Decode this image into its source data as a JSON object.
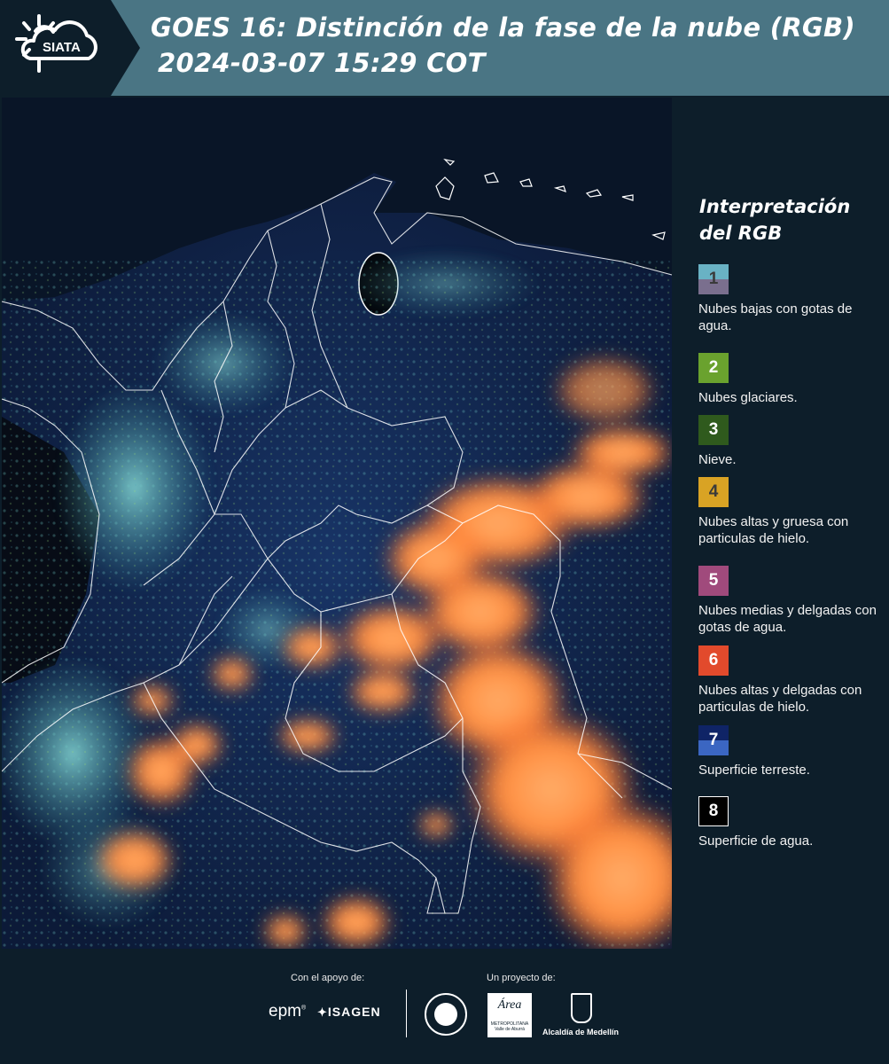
{
  "header": {
    "logo_text": "SIATA",
    "title_line1": "GOES 16: Distinción de la fase de la nube (RGB)",
    "title_line2": "2024-03-07 15:29 COT",
    "background_color": "#4a7584"
  },
  "legend": {
    "title": "Interpretación del RGB",
    "items": [
      {
        "number": "1",
        "label": "Nubes bajas con gotas de agua.",
        "color_top": "#69b2c4",
        "color_bottom": "#7a6f8e"
      },
      {
        "number": "2",
        "label": "Nubes glaciares.",
        "color_top": "#6aa22e",
        "color_bottom": "#6aa22e"
      },
      {
        "number": "3",
        "label": "Nieve.",
        "color_top": "#2f5a1d",
        "color_bottom": "#2f5a1d"
      },
      {
        "number": "4",
        "label": "Nubes altas y gruesa con particulas de hielo.",
        "color_top": "#d9a324",
        "color_bottom": "#d9a324"
      },
      {
        "number": "5",
        "label": "Nubes medias y delgadas con gotas de agua.",
        "color_top": "#a04a7c",
        "color_bottom": "#a04a7c"
      },
      {
        "number": "6",
        "label": "Nubes altas y delgadas con particulas de hielo.",
        "color_top": "#e24a2c",
        "color_bottom": "#e24a2c"
      },
      {
        "number": "7",
        "label": "Superficie terreste.",
        "color_top": "#0f2466",
        "color_bottom": "#3b66c2"
      },
      {
        "number": "8",
        "label": "Superficie de agua.",
        "color_top": "#000000",
        "color_bottom": "#000000"
      }
    ]
  },
  "footer": {
    "support_label": "Con el apoyo de:",
    "project_label": "Un proyecto de:",
    "sponsors": [
      "epm",
      "ISAGEN"
    ],
    "partners": [
      "Área Metropolitana Valle de Aburrá",
      "Alcaldía de Medellín"
    ],
    "partner_alcaldia_text": "Alcaldía de Medellín",
    "partner_area_text": "Área",
    "partner_area_sub1": "METROPOLITANA",
    "partner_area_sub2": "Valle de Aburrá"
  },
  "map": {
    "type": "satellite RGB cloud phase composite",
    "land_color": "#102244",
    "water_color": "#05080d",
    "ice_cloud_color": "#ff8a3c",
    "low_cloud_color": "#5fb3bf",
    "border_color": "#ffffff"
  }
}
